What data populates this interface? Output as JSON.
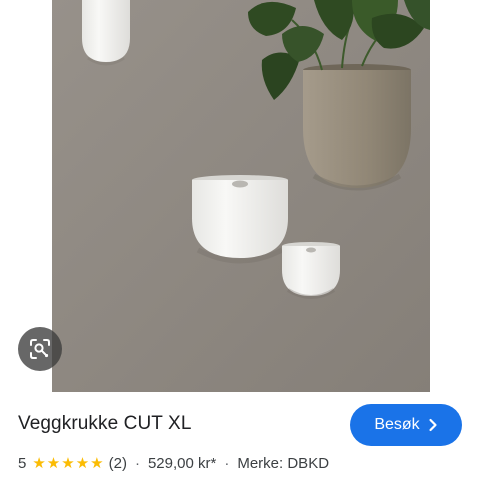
{
  "image": {
    "description_icon": "product-photo"
  },
  "lens": {
    "icon": "lens-search-icon"
  },
  "product": {
    "title": "Veggkrukke CUT XL",
    "rating": "5",
    "stars": 5,
    "review_count": "(2)",
    "price": "529,00 kr*",
    "brand": "Merke: DBKD",
    "separator": "·"
  },
  "visit_button": {
    "label": "Besøk",
    "icon": "chevron-right-icon",
    "color": "#1a73e8"
  },
  "colors": {
    "star": "#fbbc04",
    "wall": "#8e8880",
    "pot_taupe": "#918776",
    "pot_white": "#f3f3f1"
  }
}
